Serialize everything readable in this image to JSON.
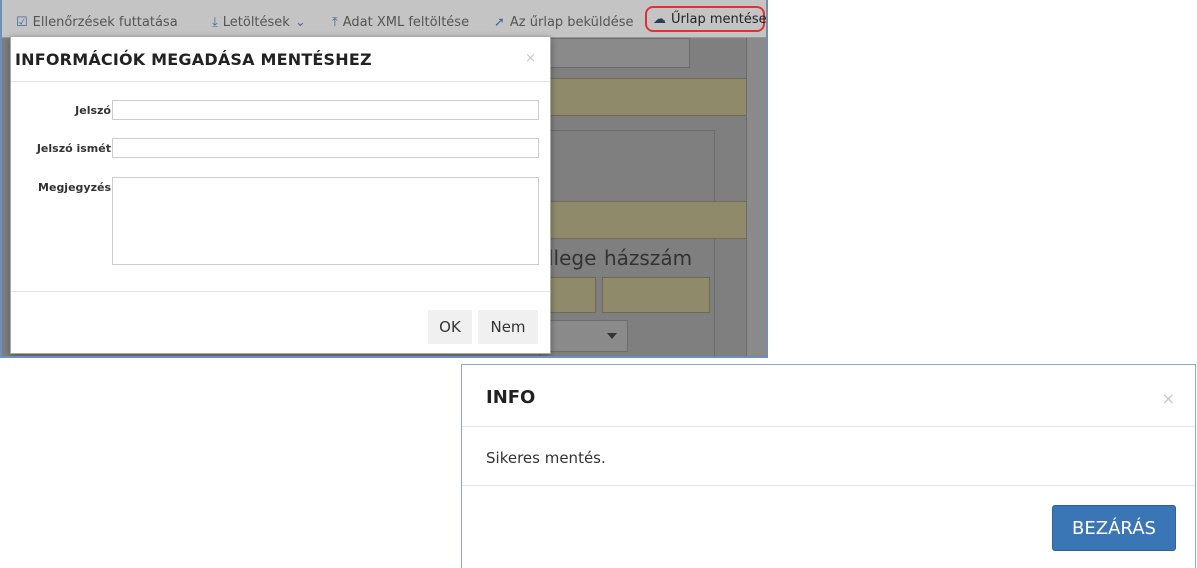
{
  "toolbar": {
    "checks": {
      "label": "Ellenőrzések futtatása",
      "icon": "check-square-icon"
    },
    "downloads": {
      "label": "Letöltések",
      "icon": "download-icon"
    },
    "xml_upload": {
      "label": "Adat XML feltöltése",
      "icon": "upload-icon"
    },
    "submit": {
      "label": "Az űrlap beküldése",
      "icon": "send-icon"
    },
    "save": {
      "label": "Űrlap mentése",
      "icon": "cloud-upload-icon",
      "highlight_color": "#dd3333"
    }
  },
  "background_form": {
    "street_type_label": "llege",
    "house_number_label": "házszám"
  },
  "save_dialog": {
    "title": "INFORMÁCIÓK MEGADÁSA MENTÉSHEZ",
    "close": "×",
    "fields": {
      "password": {
        "label": "Jelszó",
        "value": ""
      },
      "password_again": {
        "label": "Jelszó ismét",
        "value": ""
      },
      "note": {
        "label": "Megjegyzés",
        "value": ""
      }
    },
    "ok_label": "OK",
    "no_label": "Nem"
  },
  "info_dialog": {
    "title": "INFO",
    "close": "×",
    "message": "Sikeres mentés.",
    "close_button": "BEZÁRÁS",
    "button_color": "#3a76b6"
  }
}
